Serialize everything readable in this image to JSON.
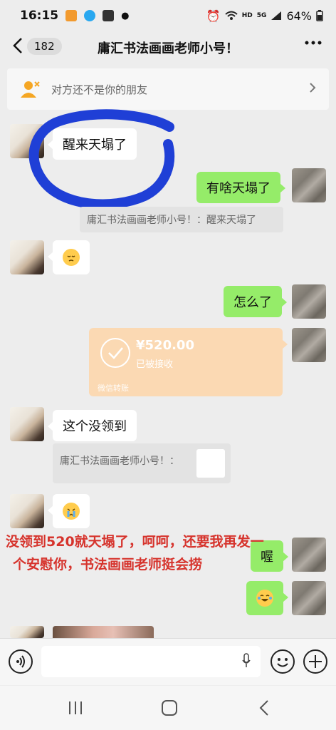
{
  "status_bar": {
    "time": "16:15",
    "network_type": "HD",
    "network_gen": "5G",
    "battery": "64%"
  },
  "header": {
    "unread_count": "182",
    "title": "庸汇书法画画老师小号！"
  },
  "notice": {
    "text": "对方还不是你的朋友"
  },
  "messages": [
    {
      "side": "left",
      "text": "醒来天塌了"
    },
    {
      "side": "right",
      "text": "有啥天塌了"
    },
    {
      "quote": "庸汇书法画画老师小号！：醒来天塌了"
    },
    {
      "side": "left",
      "emoji": "pensive-face"
    },
    {
      "side": "right",
      "text": "怎么了"
    },
    {
      "side": "right",
      "transfer_amount": "¥520.00",
      "transfer_status": "已被接收",
      "transfer_footer": "微信转账"
    },
    {
      "side": "left",
      "text": "这个没领到"
    },
    {
      "quote": "庸汇书法画画老师小号！："
    },
    {
      "side": "left",
      "emoji": "crying-face"
    },
    {
      "side": "right",
      "text": "喔"
    },
    {
      "side": "right",
      "emoji": "laughing-tears-face"
    }
  ],
  "overlay": {
    "line1": "没领到520就天塌了，呵呵，还要我再发一",
    "line2": "个安慰你，书法画画老师挺会捞"
  },
  "colors": {
    "bg": "#ededed",
    "green_bubble": "#95ec69",
    "transfer_bg": "#fbd9b3",
    "annotation_red": "#d6332c",
    "circle_blue": "#1f3fd6"
  }
}
